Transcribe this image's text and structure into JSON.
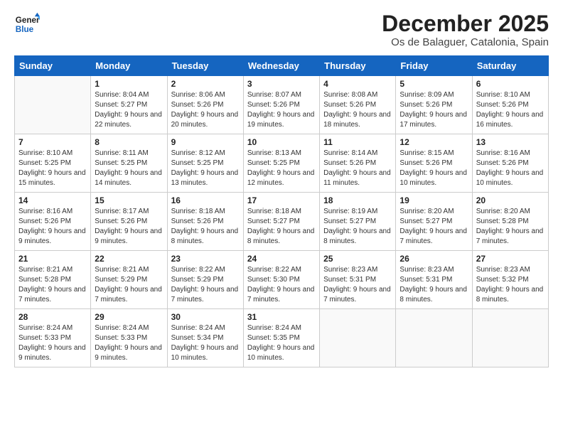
{
  "logo": {
    "line1": "General",
    "line2": "Blue"
  },
  "title": "December 2025",
  "location": "Os de Balaguer, Catalonia, Spain",
  "weekdays": [
    "Sunday",
    "Monday",
    "Tuesday",
    "Wednesday",
    "Thursday",
    "Friday",
    "Saturday"
  ],
  "weeks": [
    [
      {
        "num": "",
        "sunrise": "",
        "sunset": "",
        "daylight": ""
      },
      {
        "num": "1",
        "sunrise": "Sunrise: 8:04 AM",
        "sunset": "Sunset: 5:27 PM",
        "daylight": "Daylight: 9 hours and 22 minutes."
      },
      {
        "num": "2",
        "sunrise": "Sunrise: 8:06 AM",
        "sunset": "Sunset: 5:26 PM",
        "daylight": "Daylight: 9 hours and 20 minutes."
      },
      {
        "num": "3",
        "sunrise": "Sunrise: 8:07 AM",
        "sunset": "Sunset: 5:26 PM",
        "daylight": "Daylight: 9 hours and 19 minutes."
      },
      {
        "num": "4",
        "sunrise": "Sunrise: 8:08 AM",
        "sunset": "Sunset: 5:26 PM",
        "daylight": "Daylight: 9 hours and 18 minutes."
      },
      {
        "num": "5",
        "sunrise": "Sunrise: 8:09 AM",
        "sunset": "Sunset: 5:26 PM",
        "daylight": "Daylight: 9 hours and 17 minutes."
      },
      {
        "num": "6",
        "sunrise": "Sunrise: 8:10 AM",
        "sunset": "Sunset: 5:26 PM",
        "daylight": "Daylight: 9 hours and 16 minutes."
      }
    ],
    [
      {
        "num": "7",
        "sunrise": "Sunrise: 8:10 AM",
        "sunset": "Sunset: 5:25 PM",
        "daylight": "Daylight: 9 hours and 15 minutes."
      },
      {
        "num": "8",
        "sunrise": "Sunrise: 8:11 AM",
        "sunset": "Sunset: 5:25 PM",
        "daylight": "Daylight: 9 hours and 14 minutes."
      },
      {
        "num": "9",
        "sunrise": "Sunrise: 8:12 AM",
        "sunset": "Sunset: 5:25 PM",
        "daylight": "Daylight: 9 hours and 13 minutes."
      },
      {
        "num": "10",
        "sunrise": "Sunrise: 8:13 AM",
        "sunset": "Sunset: 5:25 PM",
        "daylight": "Daylight: 9 hours and 12 minutes."
      },
      {
        "num": "11",
        "sunrise": "Sunrise: 8:14 AM",
        "sunset": "Sunset: 5:26 PM",
        "daylight": "Daylight: 9 hours and 11 minutes."
      },
      {
        "num": "12",
        "sunrise": "Sunrise: 8:15 AM",
        "sunset": "Sunset: 5:26 PM",
        "daylight": "Daylight: 9 hours and 10 minutes."
      },
      {
        "num": "13",
        "sunrise": "Sunrise: 8:16 AM",
        "sunset": "Sunset: 5:26 PM",
        "daylight": "Daylight: 9 hours and 10 minutes."
      }
    ],
    [
      {
        "num": "14",
        "sunrise": "Sunrise: 8:16 AM",
        "sunset": "Sunset: 5:26 PM",
        "daylight": "Daylight: 9 hours and 9 minutes."
      },
      {
        "num": "15",
        "sunrise": "Sunrise: 8:17 AM",
        "sunset": "Sunset: 5:26 PM",
        "daylight": "Daylight: 9 hours and 9 minutes."
      },
      {
        "num": "16",
        "sunrise": "Sunrise: 8:18 AM",
        "sunset": "Sunset: 5:26 PM",
        "daylight": "Daylight: 9 hours and 8 minutes."
      },
      {
        "num": "17",
        "sunrise": "Sunrise: 8:18 AM",
        "sunset": "Sunset: 5:27 PM",
        "daylight": "Daylight: 9 hours and 8 minutes."
      },
      {
        "num": "18",
        "sunrise": "Sunrise: 8:19 AM",
        "sunset": "Sunset: 5:27 PM",
        "daylight": "Daylight: 9 hours and 8 minutes."
      },
      {
        "num": "19",
        "sunrise": "Sunrise: 8:20 AM",
        "sunset": "Sunset: 5:27 PM",
        "daylight": "Daylight: 9 hours and 7 minutes."
      },
      {
        "num": "20",
        "sunrise": "Sunrise: 8:20 AM",
        "sunset": "Sunset: 5:28 PM",
        "daylight": "Daylight: 9 hours and 7 minutes."
      }
    ],
    [
      {
        "num": "21",
        "sunrise": "Sunrise: 8:21 AM",
        "sunset": "Sunset: 5:28 PM",
        "daylight": "Daylight: 9 hours and 7 minutes."
      },
      {
        "num": "22",
        "sunrise": "Sunrise: 8:21 AM",
        "sunset": "Sunset: 5:29 PM",
        "daylight": "Daylight: 9 hours and 7 minutes."
      },
      {
        "num": "23",
        "sunrise": "Sunrise: 8:22 AM",
        "sunset": "Sunset: 5:29 PM",
        "daylight": "Daylight: 9 hours and 7 minutes."
      },
      {
        "num": "24",
        "sunrise": "Sunrise: 8:22 AM",
        "sunset": "Sunset: 5:30 PM",
        "daylight": "Daylight: 9 hours and 7 minutes."
      },
      {
        "num": "25",
        "sunrise": "Sunrise: 8:23 AM",
        "sunset": "Sunset: 5:31 PM",
        "daylight": "Daylight: 9 hours and 7 minutes."
      },
      {
        "num": "26",
        "sunrise": "Sunrise: 8:23 AM",
        "sunset": "Sunset: 5:31 PM",
        "daylight": "Daylight: 9 hours and 8 minutes."
      },
      {
        "num": "27",
        "sunrise": "Sunrise: 8:23 AM",
        "sunset": "Sunset: 5:32 PM",
        "daylight": "Daylight: 9 hours and 8 minutes."
      }
    ],
    [
      {
        "num": "28",
        "sunrise": "Sunrise: 8:24 AM",
        "sunset": "Sunset: 5:33 PM",
        "daylight": "Daylight: 9 hours and 9 minutes."
      },
      {
        "num": "29",
        "sunrise": "Sunrise: 8:24 AM",
        "sunset": "Sunset: 5:33 PM",
        "daylight": "Daylight: 9 hours and 9 minutes."
      },
      {
        "num": "30",
        "sunrise": "Sunrise: 8:24 AM",
        "sunset": "Sunset: 5:34 PM",
        "daylight": "Daylight: 9 hours and 10 minutes."
      },
      {
        "num": "31",
        "sunrise": "Sunrise: 8:24 AM",
        "sunset": "Sunset: 5:35 PM",
        "daylight": "Daylight: 9 hours and 10 minutes."
      },
      {
        "num": "",
        "sunrise": "",
        "sunset": "",
        "daylight": ""
      },
      {
        "num": "",
        "sunrise": "",
        "sunset": "",
        "daylight": ""
      },
      {
        "num": "",
        "sunrise": "",
        "sunset": "",
        "daylight": ""
      }
    ]
  ]
}
